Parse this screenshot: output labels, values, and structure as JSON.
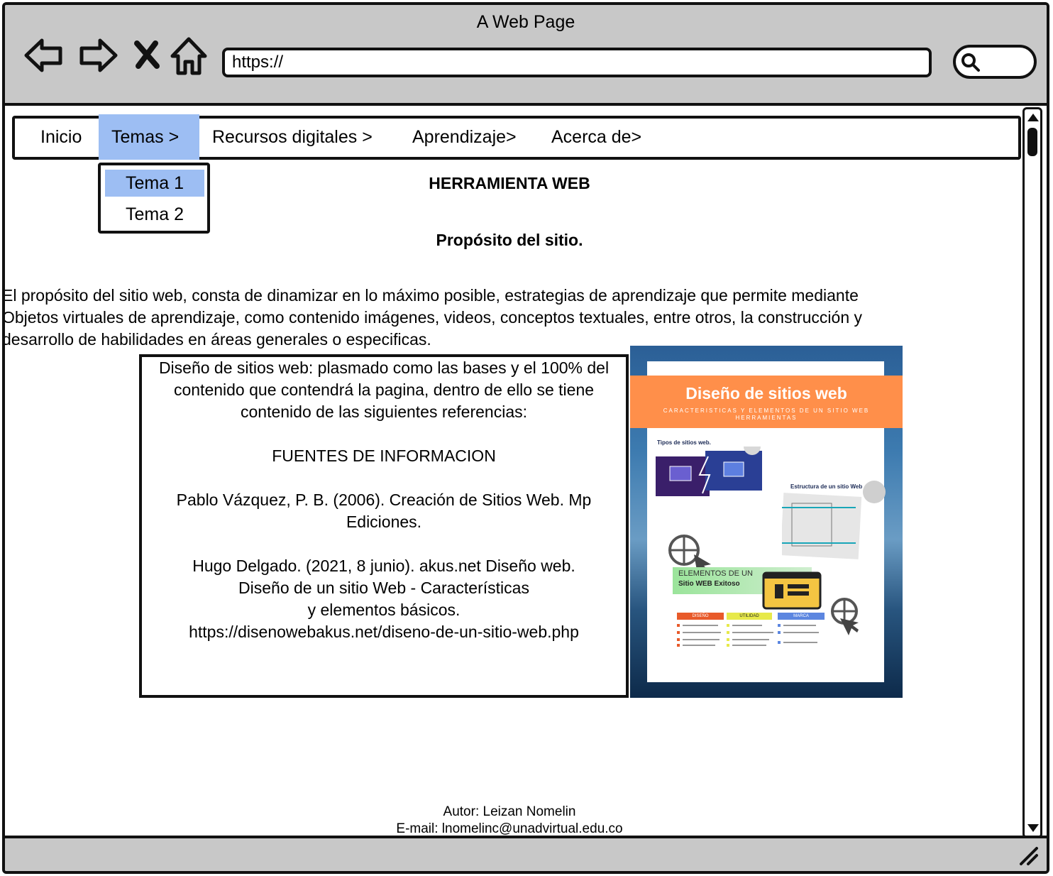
{
  "window": {
    "title": "A Web Page"
  },
  "address_bar": {
    "url": "https://"
  },
  "menu": {
    "items": [
      "Inicio",
      "Temas >",
      "Recursos digitales >",
      "Aprendizaje>",
      "Acerca de>"
    ],
    "active_index": 1
  },
  "dropdown": {
    "items": [
      "Tema 1",
      "Tema 2"
    ],
    "selected_index": 0
  },
  "page": {
    "title": "HERRAMIENTA WEB",
    "subtitle": "Propósito del sitio.",
    "purpose_lines": [
      "El propósito del sitio web, consta de dinamizar en lo máximo posible, estrategias de aprendizaje que permite mediante",
      "Objetos virtuales de aprendizaje, como contenido imágenes, videos, conceptos textuales, entre otros, la construcción y",
      "desarrollo de habilidades en áreas generales o especificas."
    ]
  },
  "references": {
    "intro": "Diseño de sitios web: plasmado como las bases y el 100% del contenido que contendrá la pagina, dentro de ello se tiene contenido de las siguientes referencias:",
    "heading": "FUENTES DE INFORMACION",
    "ref1": "Pablo Vázquez, P. B. (2006). Creación de Sitios Web. Mp Ediciones.",
    "ref2_line1": "Hugo Delgado. (2021, 8 junio). akus.net Diseño web.",
    "ref2_line2": "Diseño de un sitio Web - Características",
    "ref2_line3": "y elementos básicos.",
    "ref2_url": "https://disenowebakus.net/diseno-de-un-sitio-web.php"
  },
  "infographic": {
    "title": "Diseño de sitios web",
    "subtitle_line1": "CARACTERISTICAS Y ELEMENTOS DE UN SITIO WEB",
    "subtitle_line2": "HERRAMIENTAS",
    "label_types": "Tipos de sitios web.",
    "label_structure": "Estructura de un sitio Web",
    "label_elements": "ELEMENTOS DE UN",
    "label_elements2": "Sitio WEB Exitoso",
    "col_design": "DISEÑO",
    "col_utility": "UTILIDAD",
    "col_brand": "MARCA"
  },
  "footer": {
    "author": "Autor: Leizan Nomelin",
    "email": "E-mail: lnomelinc@unadvirtual.edu.co"
  },
  "colors": {
    "chrome": "#c8c8c8",
    "highlight": "#9dbef3",
    "banner": "#ff8f4a"
  }
}
